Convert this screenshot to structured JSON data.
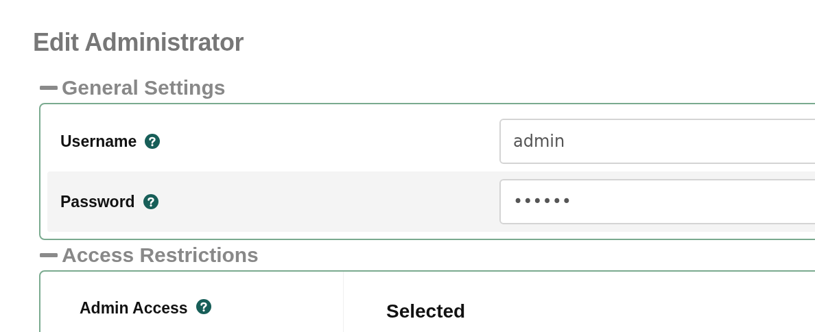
{
  "page_title": "Edit Administrator",
  "sections": [
    {
      "title": "General Settings",
      "expanded": true,
      "kind": "fields",
      "rows": [
        {
          "label": "Username",
          "value": "admin"
        },
        {
          "label": "Password",
          "value": "••••••"
        }
      ]
    },
    {
      "title": "Access Restrictions",
      "expanded": true,
      "kind": "access",
      "label": "Admin Access",
      "column_heading": "Selected"
    }
  ]
}
